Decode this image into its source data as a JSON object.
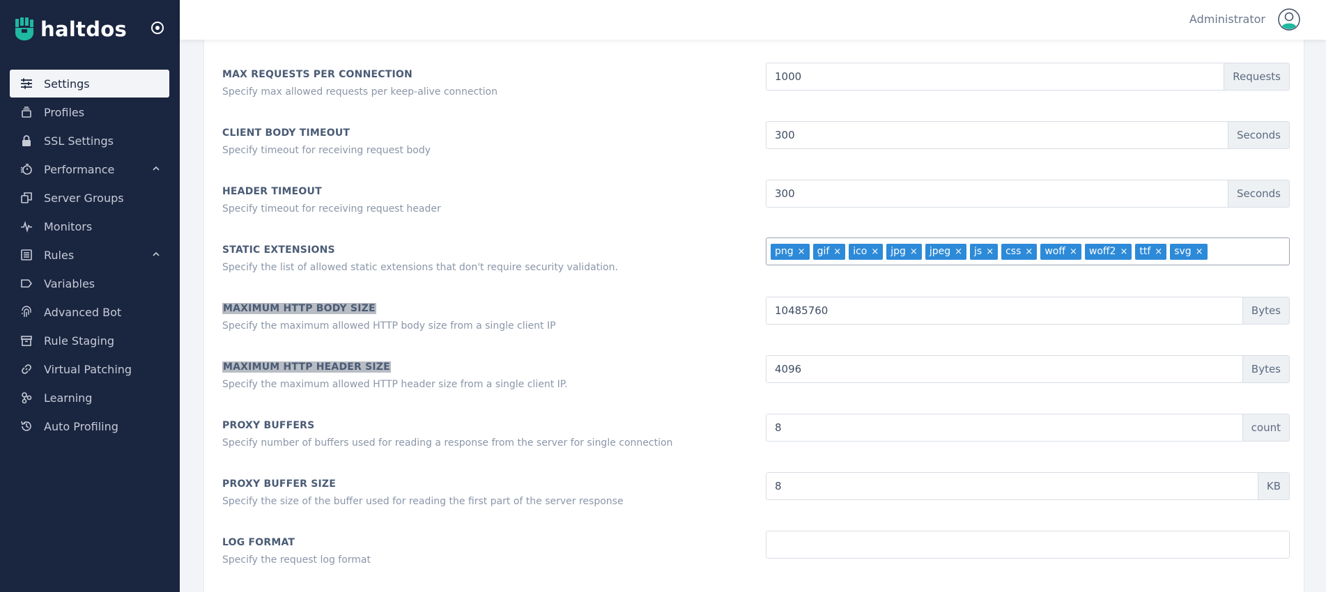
{
  "brand": {
    "name": "haltdos"
  },
  "colors": {
    "sidebar_bg": "#1a2540",
    "accent": "#2d8ad8",
    "logo": "#1fb8a0"
  },
  "sidebar": {
    "items": [
      {
        "label": "Settings",
        "icon": "sliders-icon",
        "active": true
      },
      {
        "label": "Profiles",
        "icon": "stack-icon"
      },
      {
        "label": "SSL Settings",
        "icon": "lock-icon"
      },
      {
        "label": "Performance",
        "icon": "stopwatch-icon",
        "expandable": true
      },
      {
        "label": "Server Groups",
        "icon": "copy-icon"
      },
      {
        "label": "Monitors",
        "icon": "activity-icon"
      },
      {
        "label": "Rules",
        "icon": "list-icon",
        "expandable": true
      },
      {
        "label": "Variables",
        "icon": "tag-icon"
      },
      {
        "label": "Advanced Bot",
        "icon": "fingerprint-icon"
      },
      {
        "label": "Rule Staging",
        "icon": "archive-icon"
      },
      {
        "label": "Virtual Patching",
        "icon": "link-icon"
      },
      {
        "label": "Learning",
        "icon": "nodes-icon"
      },
      {
        "label": "Auto Profiling",
        "icon": "history-icon"
      }
    ]
  },
  "header": {
    "user": "Administrator"
  },
  "settings": {
    "max_requests": {
      "title": "MAX REQUESTS PER CONNECTION",
      "desc": "Specify max allowed requests per keep-alive connection",
      "value": "1000",
      "unit": "Requests"
    },
    "client_body_timeout": {
      "title": "CLIENT BODY TIMEOUT",
      "desc": "Specify timeout for receiving request body",
      "value": "300",
      "unit": "Seconds"
    },
    "header_timeout": {
      "title": "HEADER TIMEOUT",
      "desc": "Specify timeout for receiving request header",
      "value": "300",
      "unit": "Seconds"
    },
    "static_extensions": {
      "title": "STATIC EXTENSIONS",
      "desc": "Specify the list of allowed static extensions that don't require security validation.",
      "tags": [
        "png",
        "gif",
        "ico",
        "jpg",
        "jpeg",
        "js",
        "css",
        "woff",
        "woff2",
        "ttf",
        "svg"
      ],
      "remove_symbol": "×"
    },
    "max_body_size": {
      "title": "MAXIMUM HTTP BODY SIZE",
      "desc": "Specify the maximum allowed HTTP body size from a single client IP",
      "value": "10485760",
      "unit": "Bytes"
    },
    "max_header_size": {
      "title": "MAXIMUM HTTP HEADER SIZE",
      "desc": "Specify the maximum allowed HTTP header size from a single client IP.",
      "value": "4096",
      "unit": "Bytes"
    },
    "proxy_buffers": {
      "title": "PROXY BUFFERS",
      "desc": "Specify number of buffers used for reading a response from the server for single connection",
      "value": "8",
      "unit": "count"
    },
    "proxy_buffer_size": {
      "title": "PROXY BUFFER SIZE",
      "desc": "Specify the size of the buffer used for reading the first part of the server response",
      "value": "8",
      "unit": "KB"
    },
    "log_format": {
      "title": "LOG FORMAT",
      "desc": "Specify the request log format",
      "value": ""
    }
  }
}
